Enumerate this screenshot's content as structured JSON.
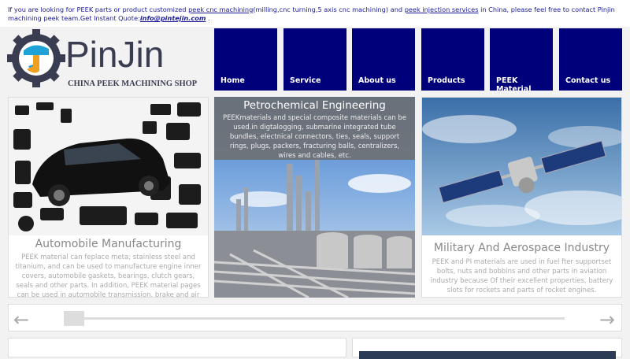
{
  "topbar": {
    "text1": "If you are looking for PEEK parts or product customized ",
    "link1": "peek cnc machining",
    "text2": "(milling,cnc turning,5 axis cnc machining) and ",
    "link2": "peek injection services",
    "text3": " in China, please feel free to contact Pinjin machining peek team.Get Instant Quote:",
    "email": "info@pintejin.com",
    "text4": " ."
  },
  "logo": {
    "name": "PinJin",
    "tagline": "CHINA PEEK MACHINING SHOP"
  },
  "nav": [
    "Home",
    "Service",
    "About us",
    "Products",
    "PEEK Material",
    "Contact us"
  ],
  "cards": [
    {
      "title": "Automobile Manufacturing",
      "text": "PEEK material can feplace meta; stainless steel and titanium, and can be used to manufacture engine inner covers, automobile gaskets, bearings, clutch gears, seals and other parts. In addition, PEEK material pages can be used in automobile transmission, brake and air"
    },
    {
      "title": "Petrochemical Engineering",
      "text": "PEEKmaterials and special composite materials can be used.in digtalogging, submarine integrated tube bundles, electnical connectors, ties, seals, support rings, plugs, packers, fracturing balls, centralizers, wires and cables, etc."
    },
    {
      "title": "Military And Aerospace Industry",
      "text": "PEEK and PI materials are used in fuel fter supportset bolts, nuts and bobbins and other parts in aviation industry because Of their excellent properties, battery slots for rockets and parts of rocket engines."
    }
  ],
  "slider": {
    "prev": "←",
    "next": "→"
  }
}
